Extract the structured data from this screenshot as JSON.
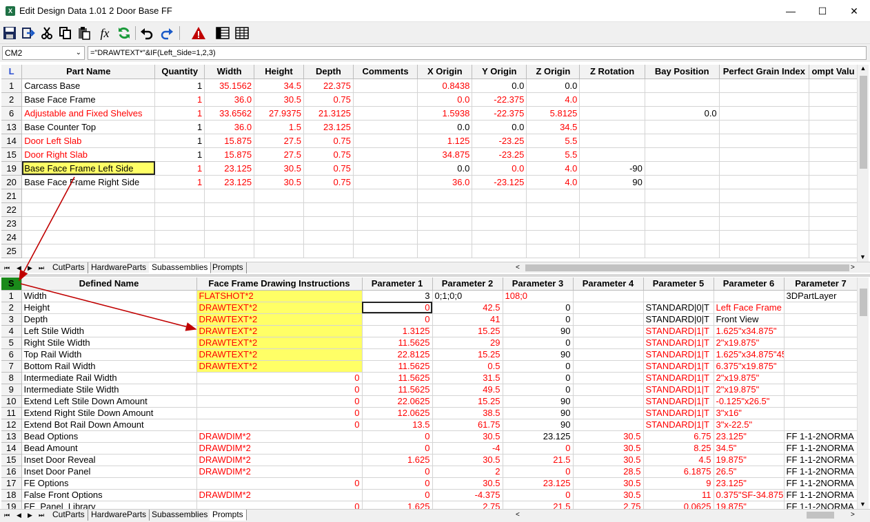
{
  "window": {
    "title": "Edit Design Data 1.01 2 Door Base FF",
    "app_icon": "excel-icon",
    "minimize": "—",
    "maximize": "☐",
    "close": "✕"
  },
  "toolbar": {
    "icons": [
      "save-icon",
      "export-icon",
      "cut-icon",
      "copy-icon",
      "paste-icon",
      "function-icon",
      "refresh-icon",
      "undo-icon",
      "redo-icon",
      "warning-icon",
      "grid-view-icon",
      "table-view-icon"
    ]
  },
  "formula_bar": {
    "cell_ref": "CM2",
    "formula": "=\"DRAWTEXT*\"&IF(Left_Side=1,2,3)"
  },
  "top_grid": {
    "corner": "L",
    "headers": [
      "Part Name",
      "Quantity",
      "Width",
      "Height",
      "Depth",
      "Comments",
      "X Origin",
      "Y Origin",
      "Z Origin",
      "Z Rotation",
      "Bay Position",
      "Perfect Grain Index",
      "ompt Valu"
    ],
    "rows": [
      {
        "n": "1",
        "name": "Carcass Base",
        "qty": "1",
        "w": "35.1562",
        "h": "34.5",
        "d": "22.375",
        "x": "0.8438",
        "y": "0.0",
        "z": "0.0",
        "rot": "",
        "bay": ""
      },
      {
        "n": "2",
        "name": "Base Face Frame",
        "qty": "1",
        "w": "36.0",
        "h": "30.5",
        "d": "0.75",
        "x": "0.0",
        "y": "-22.375",
        "z": "4.0",
        "rot": "",
        "bay": ""
      },
      {
        "n": "6",
        "name": "Adjustable and Fixed Shelves",
        "qty": "1",
        "w": "33.6562",
        "h": "27.9375",
        "d": "21.3125",
        "x": "1.5938",
        "y": "-22.375",
        "z": "5.8125",
        "rot": "",
        "bay": "0.0"
      },
      {
        "n": "13",
        "name": "Base Counter Top",
        "qty": "1",
        "w": "36.0",
        "h": "1.5",
        "d": "23.125",
        "x": "0.0",
        "y": "0.0",
        "z": "34.5",
        "rot": "",
        "bay": ""
      },
      {
        "n": "14",
        "name": "Door Left Slab",
        "qty": "1",
        "w": "15.875",
        "h": "27.5",
        "d": "0.75",
        "x": "1.125",
        "y": "-23.25",
        "z": "5.5",
        "rot": "",
        "bay": ""
      },
      {
        "n": "15",
        "name": "Door Right Slab",
        "qty": "1",
        "w": "15.875",
        "h": "27.5",
        "d": "0.75",
        "x": "34.875",
        "y": "-23.25",
        "z": "5.5",
        "rot": "",
        "bay": ""
      },
      {
        "n": "19",
        "name": "Base Face Frame Left Side",
        "qty": "1",
        "w": "23.125",
        "h": "30.5",
        "d": "0.75",
        "x": "0.0",
        "y": "0.0",
        "z": "4.0",
        "rot": "-90",
        "bay": ""
      },
      {
        "n": "20",
        "name": "Base Face Frame Right Side",
        "qty": "1",
        "w": "23.125",
        "h": "30.5",
        "d": "0.75",
        "x": "36.0",
        "y": "-23.125",
        "z": "4.0",
        "rot": "90",
        "bay": ""
      },
      {
        "n": "21"
      },
      {
        "n": "22"
      },
      {
        "n": "23"
      },
      {
        "n": "24"
      },
      {
        "n": "25"
      }
    ]
  },
  "sheet_tabs": [
    "CutParts",
    "HardwareParts",
    "Subassemblies",
    "Prompts"
  ],
  "bottom_grid": {
    "corner": "S",
    "headers": [
      "Defined Name",
      "Face Frame Drawing Instructions",
      "Parameter 1",
      "Parameter 2",
      "Parameter 3",
      "Parameter 4",
      "Parameter 5",
      "Parameter 6",
      "Parameter 7"
    ],
    "rows": [
      {
        "n": "1",
        "name": "Width",
        "instr": "FLATSHOT*2",
        "p1": "3",
        "p2": "0;1;0;0",
        "p3": "108;0",
        "p4": "",
        "p5": "",
        "p6": "",
        "p7": "3DPartLayer"
      },
      {
        "n": "2",
        "name": "Height",
        "instr": "DRAWTEXT*2",
        "p1": "0",
        "p2": "42.5",
        "p3": "0",
        "p4": "",
        "p5": "STANDARD|0|T",
        "p6": "Left Face Frame",
        "p7": ""
      },
      {
        "n": "3",
        "name": "Depth",
        "instr": "DRAWTEXT*2",
        "p1": "0",
        "p2": "41",
        "p3": "0",
        "p4": "",
        "p5": "STANDARD|0|T",
        "p6": "Front View",
        "p7": ""
      },
      {
        "n": "4",
        "name": "Left Stile Width",
        "instr": "DRAWTEXT*2",
        "p1": "1.3125",
        "p2": "15.25",
        "p3": "90",
        "p4": "",
        "p5": "STANDARD|1|T",
        "p6": "1.625\"x34.875\"",
        "p7": ""
      },
      {
        "n": "5",
        "name": "Right Stile Width",
        "instr": "DRAWTEXT*2",
        "p1": "11.5625",
        "p2": "29",
        "p3": "0",
        "p4": "",
        "p5": "STANDARD|1|T",
        "p6": "2\"x19.875\"",
        "p7": ""
      },
      {
        "n": "6",
        "name": "Top Rail Width",
        "instr": "DRAWTEXT*2",
        "p1": "22.8125",
        "p2": "15.25",
        "p3": "90",
        "p4": "",
        "p5": "STANDARD|1|T",
        "p6": "1.625\"x34.875\"45OR",
        "p7": ""
      },
      {
        "n": "7",
        "name": "Bottom Rail Width",
        "instr": "DRAWTEXT*2",
        "p1": "11.5625",
        "p2": "0.5",
        "p3": "0",
        "p4": "",
        "p5": "STANDARD|1|T",
        "p6": "6.375\"x19.875\"",
        "p7": ""
      },
      {
        "n": "8",
        "name": "Intermediate Rail Width",
        "instr": "0",
        "p1": "11.5625",
        "p2": "31.5",
        "p3": "0",
        "p4": "",
        "p5": "STANDARD|1|T",
        "p6": "2\"x19.875\"",
        "p7": ""
      },
      {
        "n": "9",
        "name": "Intermediate Stile Width",
        "instr": "0",
        "p1": "11.5625",
        "p2": "49.5",
        "p3": "0",
        "p4": "",
        "p5": "STANDARD|1|T",
        "p6": "2\"x19.875\"",
        "p7": ""
      },
      {
        "n": "10",
        "name": "Extend Left Stile Down Amount",
        "instr": "0",
        "p1": "22.0625",
        "p2": "15.25",
        "p3": "90",
        "p4": "",
        "p5": "STANDARD|1|T",
        "p6": "-0.125\"x26.5\"",
        "p7": ""
      },
      {
        "n": "11",
        "name": "Extend Right Stile Down Amount",
        "instr": "0",
        "p1": "12.0625",
        "p2": "38.5",
        "p3": "90",
        "p4": "",
        "p5": "STANDARD|1|T",
        "p6": "3\"x16\"",
        "p7": ""
      },
      {
        "n": "12",
        "name": "Extend Bot Rail Down Amount",
        "instr": "0",
        "p1": "13.5",
        "p2": "61.75",
        "p3": "90",
        "p4": "",
        "p5": "STANDARD|1|T",
        "p6": "3\"x-22.5\"",
        "p7": ""
      },
      {
        "n": "13",
        "name": "Bead Options",
        "instr": "DRAWDIM*2",
        "p1": "0",
        "p2": "30.5",
        "p3": "23.125",
        "p4": "30.5",
        "p5": "6.75",
        "p6": "23.125\"",
        "p7": "FF 1-1-2NORMA"
      },
      {
        "n": "14",
        "name": "Bead Amount",
        "instr": "DRAWDIM*2",
        "p1": "0",
        "p2": "-4",
        "p3": "0",
        "p4": "30.5",
        "p5": "8.25",
        "p6": "34.5\"",
        "p7": "FF 1-1-2NORMA"
      },
      {
        "n": "15",
        "name": "Inset Door Reveal",
        "instr": "DRAWDIM*2",
        "p1": "1.625",
        "p2": "30.5",
        "p3": "21.5",
        "p4": "30.5",
        "p5": "4.5",
        "p6": "19.875\"",
        "p7": "FF 1-1-2NORMA"
      },
      {
        "n": "16",
        "name": "Inset Door Panel",
        "instr": "DRAWDIM*2",
        "p1": "0",
        "p2": "2",
        "p3": "0",
        "p4": "28.5",
        "p5": "6.1875",
        "p6": "26.5\"",
        "p7": "FF 1-1-2NORMA"
      },
      {
        "n": "17",
        "name": "FE Options",
        "instr": "0",
        "p1": "0",
        "p2": "30.5",
        "p3": "23.125",
        "p4": "30.5",
        "p5": "9",
        "p6": "23.125\"",
        "p7": "FF 1-1-2NORMA"
      },
      {
        "n": "18",
        "name": "False Front Options",
        "instr": "DRAWDIM*2",
        "p1": "0",
        "p2": "-4.375",
        "p3": "0",
        "p4": "30.5",
        "p5": "11",
        "p6": "0.375\"SF-34.875",
        "p7": "FF 1-1-2NORMA"
      },
      {
        "n": "19",
        "name": "FE_Panel_Library",
        "instr": "0",
        "p1": "1.625",
        "p2": "2.75",
        "p3": "21.5",
        "p4": "2.75",
        "p5": "0.0625",
        "p6": "19.875\"",
        "p7": "FF 1-1-2NORMA"
      }
    ]
  }
}
